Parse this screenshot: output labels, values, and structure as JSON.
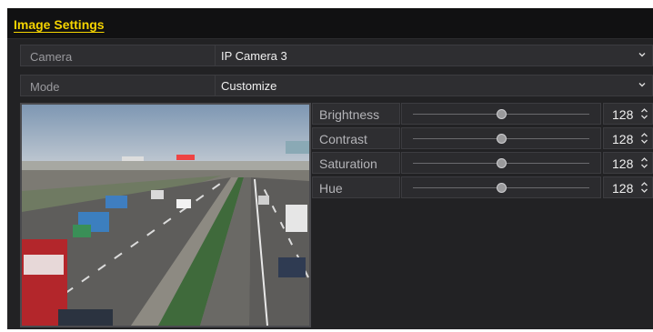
{
  "window": {
    "title": "Image Settings"
  },
  "camera": {
    "label": "Camera",
    "value": "IP Camera 3"
  },
  "mode": {
    "label": "Mode",
    "value": "Customize"
  },
  "preview": {
    "description_icon": "camera-live-preview"
  },
  "adjustments": [
    {
      "label": "Brightness",
      "value": "128",
      "level": 0.5
    },
    {
      "label": "Contrast",
      "value": "128",
      "level": 0.5
    },
    {
      "label": "Saturation",
      "value": "128",
      "level": 0.5
    },
    {
      "label": "Hue",
      "value": "128",
      "level": 0.5
    }
  ],
  "colors": {
    "title_accent": "#f5d400",
    "panel_bg": "#222224",
    "field_bg": "#2e2e31",
    "text": "#f0f0f0"
  }
}
